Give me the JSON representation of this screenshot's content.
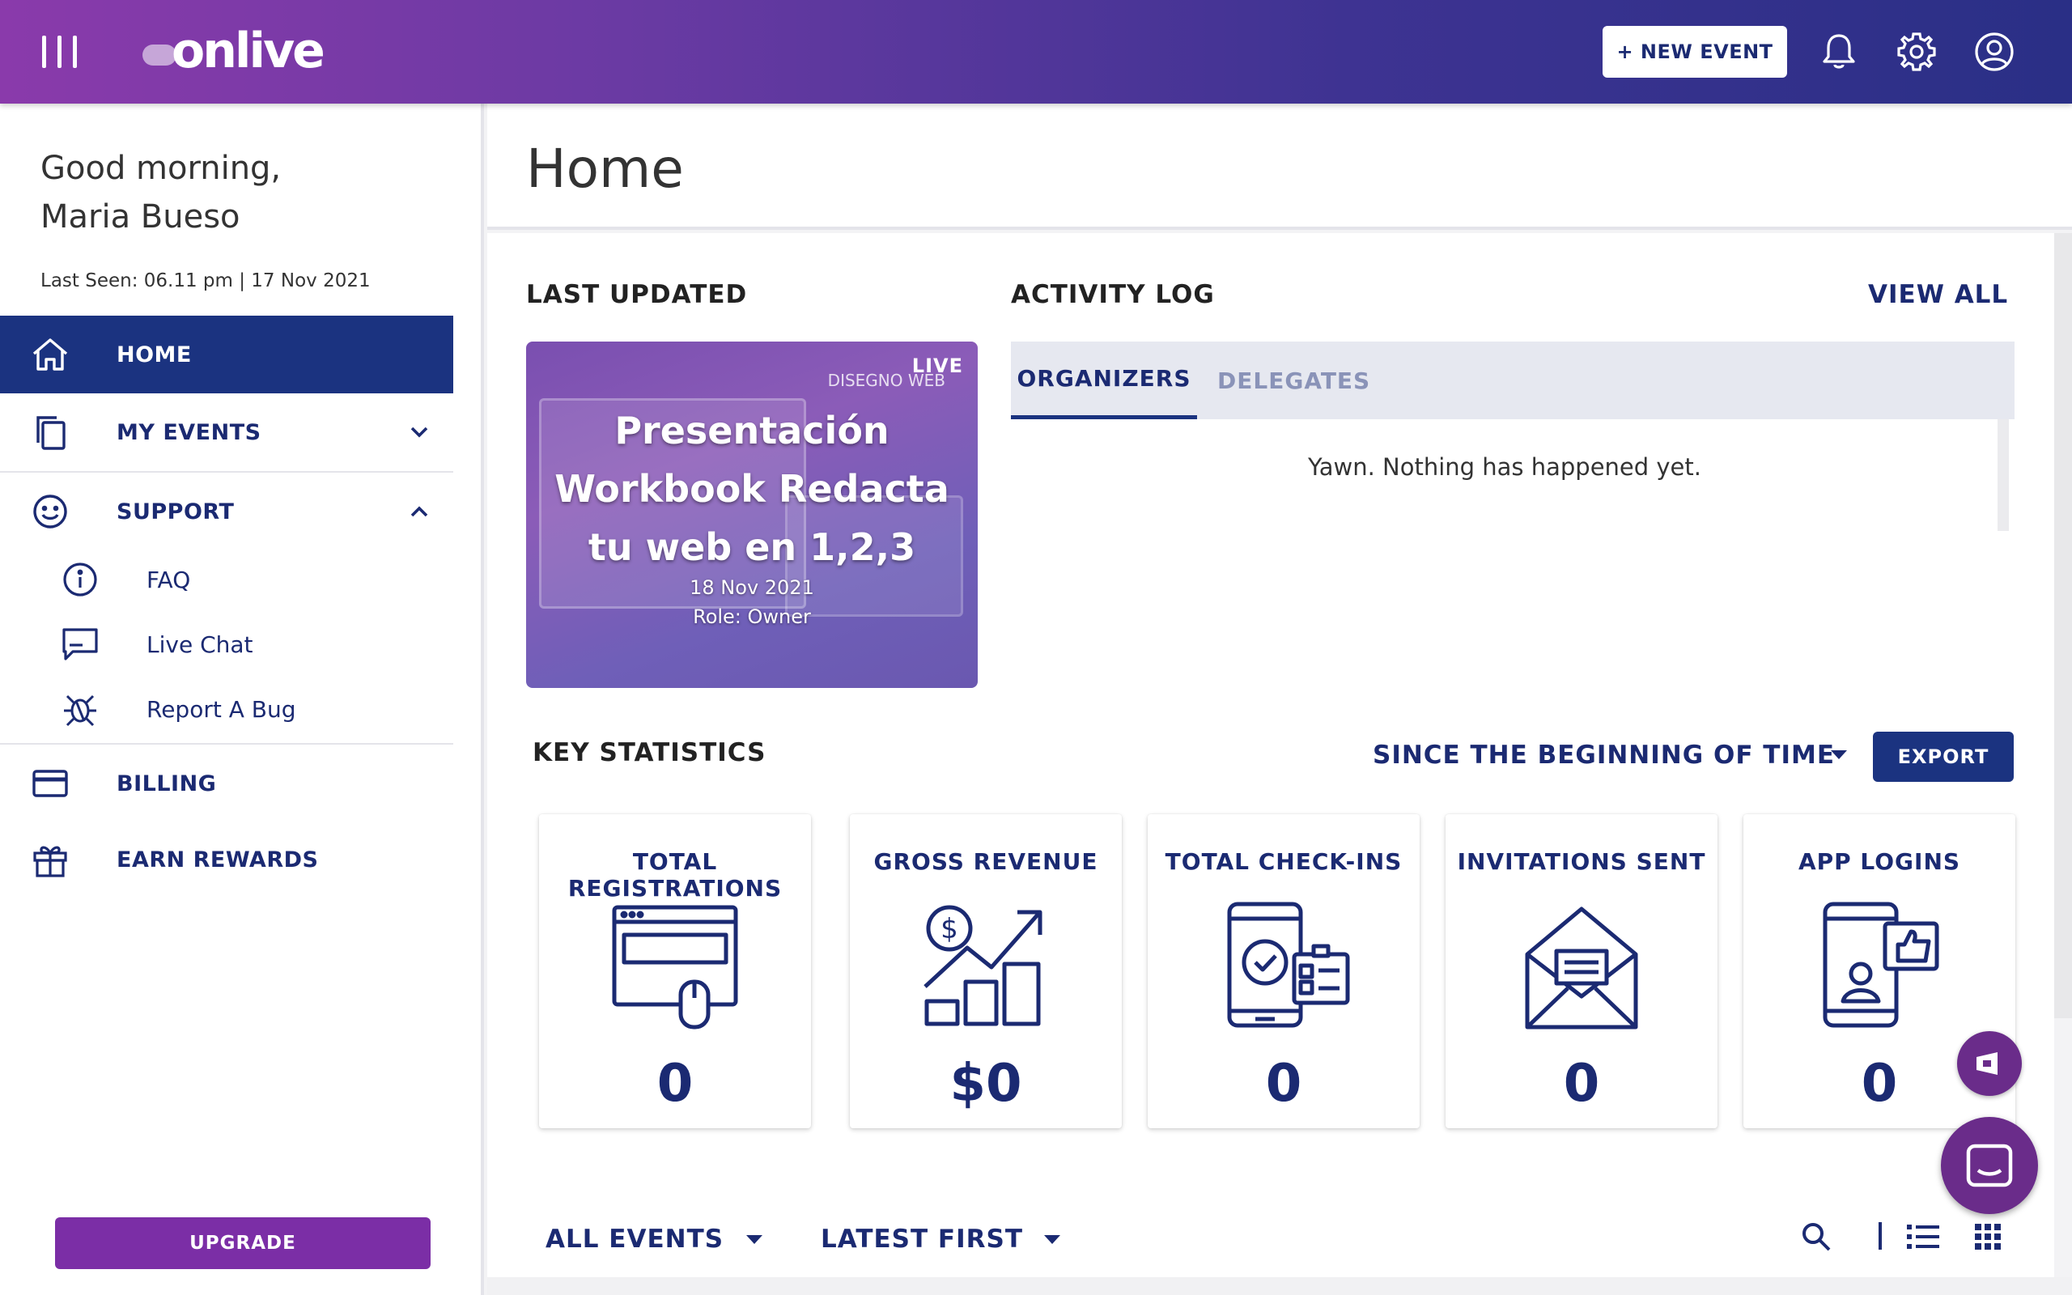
{
  "app": {
    "logo_text": "onlive",
    "new_event_label": "+ NEW EVENT"
  },
  "topbar_icons": [
    "menu-icon",
    "bell-icon",
    "gear-icon",
    "user-circle-icon"
  ],
  "sidebar": {
    "greeting_line1": "Good morning,",
    "greeting_line2": "Maria Bueso",
    "last_seen": "Last Seen: 06.11 pm | 17 Nov 2021",
    "items": [
      {
        "label": "HOME",
        "icon": "home-icon",
        "active": true
      },
      {
        "label": "MY EVENTS",
        "icon": "copy-icon",
        "expanded": false
      },
      {
        "label": "SUPPORT",
        "icon": "smiley-icon",
        "expanded": true
      },
      {
        "label": "BILLING",
        "icon": "credit-card-icon"
      },
      {
        "label": "EARN REWARDS",
        "icon": "gift-icon"
      }
    ],
    "support_items": [
      {
        "label": "FAQ",
        "icon": "info-icon"
      },
      {
        "label": "Live Chat",
        "icon": "chat-icon"
      },
      {
        "label": "Report A Bug",
        "icon": "bug-icon"
      }
    ],
    "upgrade_label": "UPGRADE"
  },
  "main": {
    "page_title": "Home",
    "last_updated": {
      "section_title": "LAST UPDATED",
      "event": {
        "live_badge": "LIVE",
        "background_tag": "DISEGNO WEB",
        "title_line1": "Presentación",
        "title_line2": "Workbook Redacta",
        "title_line3": "tu web en 1,2,3",
        "date": "18 Nov 2021",
        "role": "Role: Owner"
      }
    },
    "activity_log": {
      "section_title": "ACTIVITY LOG",
      "view_all_label": "VIEW ALL",
      "tabs": [
        {
          "label": "ORGANIZERS",
          "active": true
        },
        {
          "label": "DELEGATES",
          "active": false
        }
      ],
      "empty_message": "Yawn. Nothing has happened yet."
    },
    "key_statistics": {
      "section_title": "KEY STATISTICS",
      "range_selected": "SINCE THE BEGINNING OF TIME",
      "export_label": "EXPORT",
      "cards": [
        {
          "label": "TOTAL REGISTRATIONS",
          "value": "0",
          "icon": "registration-form-icon"
        },
        {
          "label": "GROSS REVENUE",
          "value": "$0",
          "icon": "revenue-chart-icon"
        },
        {
          "label": "TOTAL CHECK-INS",
          "value": "0",
          "icon": "mobile-checkin-icon"
        },
        {
          "label": "INVITATIONS SENT",
          "value": "0",
          "icon": "envelope-icon"
        },
        {
          "label": "APP LOGINS",
          "value": "0",
          "icon": "app-login-icon"
        }
      ]
    },
    "events_list": {
      "filter_events": "ALL EVENTS",
      "sort_order": "LATEST FIRST",
      "tool_icons": [
        "search-icon",
        "list-view-icon",
        "grid-view-icon"
      ]
    }
  },
  "colors": {
    "navy": "#1b2a72",
    "active_nav_bg": "#1b3380",
    "upgrade_purple": "#7b2ea6",
    "topbar_gradient_start": "#8a3aab",
    "topbar_gradient_end": "#2a2f86",
    "fab_purple": "#6a2c8a"
  }
}
